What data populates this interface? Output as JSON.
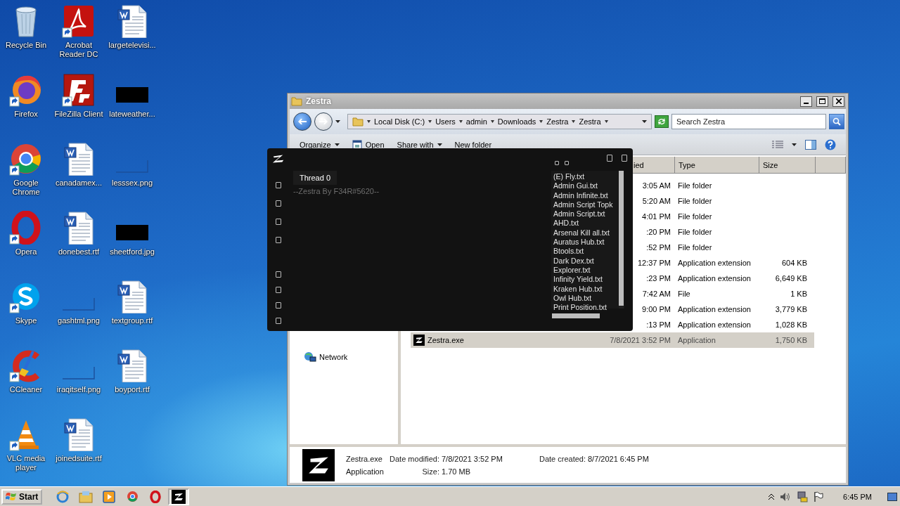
{
  "desktop": {
    "icons": [
      {
        "label": "Recycle Bin",
        "kind": "recycle",
        "shortcut": false
      },
      {
        "label": "Firefox",
        "kind": "firefox",
        "shortcut": true
      },
      {
        "label": "Google Chrome",
        "kind": "chrome",
        "shortcut": true
      },
      {
        "label": "Opera",
        "kind": "opera",
        "shortcut": true
      },
      {
        "label": "Skype",
        "kind": "skype",
        "shortcut": true
      },
      {
        "label": "CCleaner",
        "kind": "ccleaner",
        "shortcut": true
      },
      {
        "label": "VLC media player",
        "kind": "vlc",
        "shortcut": true
      },
      {
        "label": "Acrobat Reader DC",
        "kind": "acrobat",
        "shortcut": true
      },
      {
        "label": "FileZilla Client",
        "kind": "filezilla",
        "shortcut": true
      },
      {
        "label": "canadamex...",
        "kind": "word",
        "shortcut": false
      },
      {
        "label": "donebest.rtf",
        "kind": "word",
        "shortcut": false
      },
      {
        "label": "gashtml.png",
        "kind": "blank",
        "shortcut": false
      },
      {
        "label": "iraqitself.png",
        "kind": "blank",
        "shortcut": false
      },
      {
        "label": "joinedsuite.rtf",
        "kind": "word",
        "shortcut": false
      },
      {
        "label": "largetelevisi...",
        "kind": "word",
        "shortcut": false
      },
      {
        "label": "lateweather...",
        "kind": "dark",
        "shortcut": false
      },
      {
        "label": "lesssex.png",
        "kind": "blank",
        "shortcut": false
      },
      {
        "label": "sheetford.jpg",
        "kind": "dark",
        "shortcut": false
      },
      {
        "label": "textgroup.rtf",
        "kind": "word",
        "shortcut": false
      },
      {
        "label": "boyport.rtf",
        "kind": "word",
        "shortcut": false
      }
    ]
  },
  "explorer": {
    "title": "Zestra",
    "breadcrumb": [
      "Local Disk (C:)",
      "Users",
      "admin",
      "Downloads",
      "Zestra",
      "Zestra"
    ],
    "search": {
      "placeholder": "Search Zestra"
    },
    "toolbar": [
      {
        "label": "Organize",
        "kind": "menu"
      },
      {
        "label": "Open",
        "kind": "open"
      },
      {
        "label": "Share with",
        "kind": "menu"
      },
      {
        "label": "New folder",
        "kind": "plain"
      }
    ],
    "nav": [
      {
        "label": "Network",
        "kind": "network"
      }
    ],
    "columns": [
      "ied",
      "Type",
      "Size"
    ],
    "rows": [
      {
        "date": "3:05 AM",
        "type": "File folder",
        "selected": false
      },
      {
        "date": "5:20 AM",
        "type": "File folder",
        "selected": false
      },
      {
        "date": "4:01 PM",
        "type": "File folder",
        "selected": false
      },
      {
        "date": ":20 PM",
        "type": "File folder",
        "selected": false
      },
      {
        "date": ":52 PM",
        "type": "File folder",
        "selected": false
      },
      {
        "date": "12:37 PM",
        "type": "Application extension",
        "size": "604 KB",
        "selected": false
      },
      {
        "date": ":23 PM",
        "type": "Application extension",
        "size": "6,649 KB",
        "selected": false
      },
      {
        "date": "7:42 AM",
        "type": "File",
        "size": "1 KB",
        "selected": false
      },
      {
        "date": "9:00 PM",
        "type": "Application extension",
        "size": "3,779 KB",
        "selected": false
      },
      {
        "date": ":13 PM",
        "type": "Application extension",
        "size": "1,028 KB",
        "selected": false
      },
      {
        "name": "Zestra.exe",
        "date": "7/8/2021 3:52 PM",
        "type": "Application",
        "size": "1,750 KB",
        "selected": true
      }
    ],
    "details": {
      "name": "Zestra.exe",
      "type": "Application",
      "modified_label": "Date modified:",
      "modified": "7/8/2021 3:52 PM",
      "created_label": "Date created:",
      "created": "8/7/2021 6:45 PM",
      "size_label": "Size:",
      "size": "1.70 MB"
    }
  },
  "zestra": {
    "tabs": [
      {
        "label": "Thread 0",
        "selected": true
      }
    ],
    "credit": "--Zestra By F34R#5620--",
    "scripts": [
      "(E) Fly.txt",
      "Admin Gui.txt",
      "Admin Infinite.txt",
      "Admin Script Topk",
      "Admin Script.txt",
      "AHD.txt",
      "Arsenal Kill all.txt",
      "Auratus Hub.txt",
      "Btools.txt",
      "Dark Dex.txt",
      "Explorer.txt",
      "Infinity Yield.txt",
      "Kraken Hub.txt",
      "Owl Hub.txt",
      "Print Position.txt"
    ]
  },
  "taskbar": {
    "start": "Start",
    "apps": [
      {
        "kind": "ie",
        "selected": false
      },
      {
        "kind": "explorer",
        "selected": false
      },
      {
        "kind": "media",
        "selected": false
      },
      {
        "kind": "chrome",
        "selected": false
      },
      {
        "kind": "opera",
        "selected": false
      },
      {
        "kind": "zestra",
        "selected": true
      }
    ],
    "clock": "6:45 PM"
  }
}
